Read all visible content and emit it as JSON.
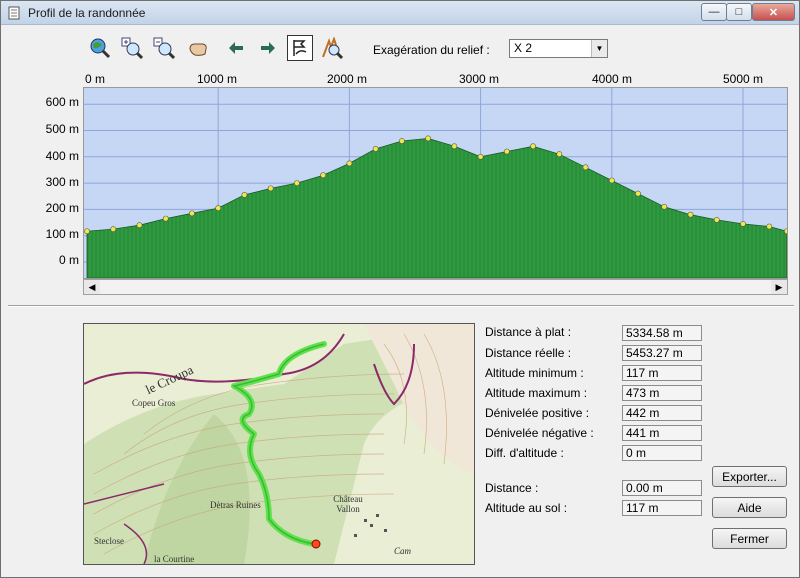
{
  "window": {
    "title": "Profil de la randonnée",
    "controls": {
      "minimize": "—",
      "maximize": "□",
      "close": "✕"
    }
  },
  "toolbar": {
    "tools": [
      {
        "icon": "globe-zoom-icon"
      },
      {
        "icon": "zoom-in-icon"
      },
      {
        "icon": "zoom-out-icon"
      },
      {
        "icon": "pan-hand-icon"
      },
      {
        "icon": "arrow-left-icon"
      },
      {
        "icon": "arrow-right-icon"
      },
      {
        "icon": "flag-path-icon",
        "active": true
      },
      {
        "icon": "profile-search-icon"
      }
    ],
    "relief_label": "Exagération du relief :",
    "relief_value": "X 2"
  },
  "profile": {
    "x_ticks": [
      "0 m",
      "1000 m",
      "2000 m",
      "3000 m",
      "4000 m",
      "5000 m"
    ],
    "y_ticks": [
      "600 m",
      "500 m",
      "400 m",
      "300 m",
      "200 m",
      "100 m",
      "0 m"
    ],
    "colors": {
      "plot_bg": "#c6d7f6",
      "fill": "#2f9a3f",
      "gridline": "#8ea6d8",
      "marker": "#f0e84a"
    }
  },
  "chart_data": {
    "type": "area",
    "xlabel": "",
    "ylabel": "",
    "xlim": [
      0,
      5334.58
    ],
    "ylim": [
      -50,
      650
    ],
    "x": [
      0,
      200,
      400,
      600,
      800,
      1000,
      1200,
      1400,
      1600,
      1800,
      2000,
      2200,
      2400,
      2600,
      2800,
      3000,
      3200,
      3400,
      3600,
      3800,
      4000,
      4200,
      4400,
      4600,
      4800,
      5000,
      5200,
      5334.58
    ],
    "series": [
      {
        "values": [
          117,
          125,
          140,
          165,
          185,
          205,
          255,
          280,
          300,
          330,
          375,
          430,
          460,
          470,
          440,
          400,
          420,
          440,
          410,
          360,
          310,
          260,
          210,
          180,
          160,
          145,
          135,
          117
        ]
      }
    ],
    "grid": true
  },
  "stats": [
    {
      "key": "flat_distance",
      "label": "Distance à plat :",
      "value": "5334.58 m"
    },
    {
      "key": "real_distance",
      "label": "Distance réelle :",
      "value": "5453.27 m"
    },
    {
      "key": "alt_min",
      "label": "Altitude minimum :",
      "value": "117 m"
    },
    {
      "key": "alt_max",
      "label": "Altitude maximum :",
      "value": "473 m"
    },
    {
      "key": "pos_gain",
      "label": "Dénivelée positive :",
      "value": "442 m"
    },
    {
      "key": "neg_gain",
      "label": "Dénivelée négative :",
      "value": "441 m"
    },
    {
      "key": "alt_diff",
      "label": "Diff. d'altitude :",
      "value": "0 m"
    }
  ],
  "cursor_stats": [
    {
      "key": "distance",
      "label": "Distance :",
      "value": "0.00 m"
    },
    {
      "key": "ground_alt",
      "label": "Altitude au sol :",
      "value": "117 m"
    }
  ],
  "buttons": {
    "export": "Exporter...",
    "help": "Aide",
    "close": "Fermer"
  },
  "map": {
    "labels": [
      "le Croupa",
      "Copeu Gros",
      "Château Vallon",
      "Dètras Ruines",
      "la Courtine",
      "Cam",
      "Steclose"
    ],
    "track_color": "#5ee34c"
  }
}
